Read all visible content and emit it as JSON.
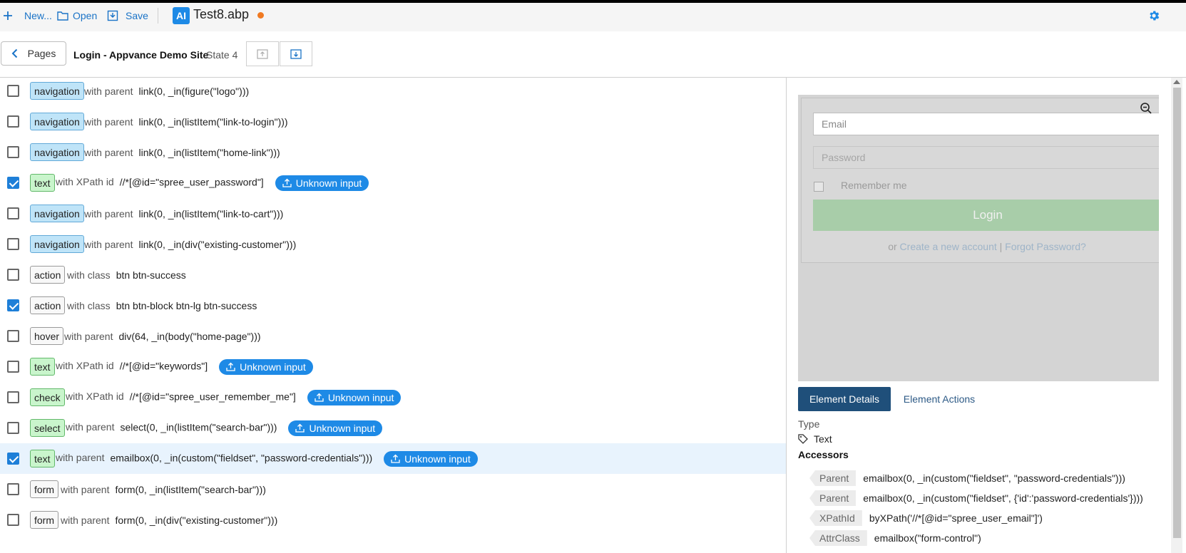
{
  "toolbar": {
    "new_label": "New...",
    "open_label": "Open",
    "save_label": "Save",
    "logo_text": "AI",
    "file_title": "Test8.abp"
  },
  "pagebar": {
    "pages_label": "Pages",
    "page_name": "Login - Appvance Demo Site",
    "state_label": "State 4"
  },
  "rows": [
    {
      "checked": false,
      "tag": "navigation",
      "kind": "navigation",
      "kw": "with parent",
      "val": "link(0, _in(figure(\"logo\")))",
      "unknown": false
    },
    {
      "checked": false,
      "tag": "navigation",
      "kind": "navigation",
      "kw": "with parent",
      "val": "link(0, _in(listItem(\"link-to-login\")))",
      "unknown": false
    },
    {
      "checked": false,
      "tag": "navigation",
      "kind": "navigation",
      "kw": "with parent",
      "val": "link(0, _in(listItem(\"home-link\")))",
      "unknown": false
    },
    {
      "checked": true,
      "tag": "text",
      "kind": "text",
      "kw": "with XPath id",
      "val": "//*[@id=\"spree_user_password\"]",
      "unknown": true
    },
    {
      "checked": false,
      "tag": "navigation",
      "kind": "navigation",
      "kw": "with parent",
      "val": "link(0, _in(listItem(\"link-to-cart\")))",
      "unknown": false
    },
    {
      "checked": false,
      "tag": "navigation",
      "kind": "navigation",
      "kw": "with parent",
      "val": "link(0, _in(div(\"existing-customer\")))",
      "unknown": false
    },
    {
      "checked": false,
      "tag": "action",
      "kind": "plain",
      "kw": "with class",
      "val": "btn btn-success",
      "unknown": false
    },
    {
      "checked": true,
      "tag": "action",
      "kind": "plain",
      "kw": "with class",
      "val": "btn btn-block btn-lg btn-success",
      "unknown": false
    },
    {
      "checked": false,
      "tag": "hover",
      "kind": "plain",
      "kw": "with parent",
      "val": "div(64, _in(body(\"home-page\")))",
      "unknown": false
    },
    {
      "checked": false,
      "tag": "text",
      "kind": "text",
      "kw": "with XPath id",
      "val": "//*[@id=\"keywords\"]",
      "unknown": true
    },
    {
      "checked": false,
      "tag": "check",
      "kind": "check",
      "kw": "with XPath id",
      "val": "//*[@id=\"spree_user_remember_me\"]",
      "unknown": true
    },
    {
      "checked": false,
      "tag": "select",
      "kind": "select",
      "kw": "with parent",
      "val": "select(0, _in(listItem(\"search-bar\")))",
      "unknown": true
    },
    {
      "checked": true,
      "tag": "text",
      "kind": "text",
      "kw": "with parent",
      "val": "emailbox(0, _in(custom(\"fieldset\", \"password-credentials\")))",
      "unknown": true,
      "selected": true
    },
    {
      "checked": false,
      "tag": "form",
      "kind": "plain",
      "kw": "with parent",
      "val": "form(0, _in(listItem(\"search-bar\")))",
      "unknown": false
    },
    {
      "checked": false,
      "tag": "form",
      "kind": "plain",
      "kw": "with parent",
      "val": "form(0, _in(div(\"existing-customer\")))",
      "unknown": false
    }
  ],
  "unknown_input_label": "Unknown input",
  "preview": {
    "email_placeholder": "Email",
    "password_placeholder": "Password",
    "remember_label": "Remember me",
    "login_label": "Login",
    "or_text": "or",
    "create_link": "Create a new account",
    "pipe": "|",
    "forgot_link": "Forgot Password?"
  },
  "details": {
    "tab_details": "Element Details",
    "tab_actions": "Element Actions",
    "type_label": "Type",
    "type_value": "Text",
    "accessors_label": "Accessors",
    "accessors": [
      {
        "chip": "Parent",
        "value": "emailbox(0, _in(custom(\"fieldset\", \"password-credentials\")))"
      },
      {
        "chip": "Parent",
        "value": "emailbox(0, _in(custom(\"fieldset\", {'id':'password-credentials'})))"
      },
      {
        "chip": "XPathId",
        "value": "byXPath('//*[@id=\"spree_user_email\"]')"
      },
      {
        "chip": "AttrClass",
        "value": "emailbox(\"form-control\")"
      }
    ]
  },
  "colors": {
    "accent": "#1e8ae6",
    "dirty": "#f07a22",
    "tab_active": "#1f4f7a"
  }
}
